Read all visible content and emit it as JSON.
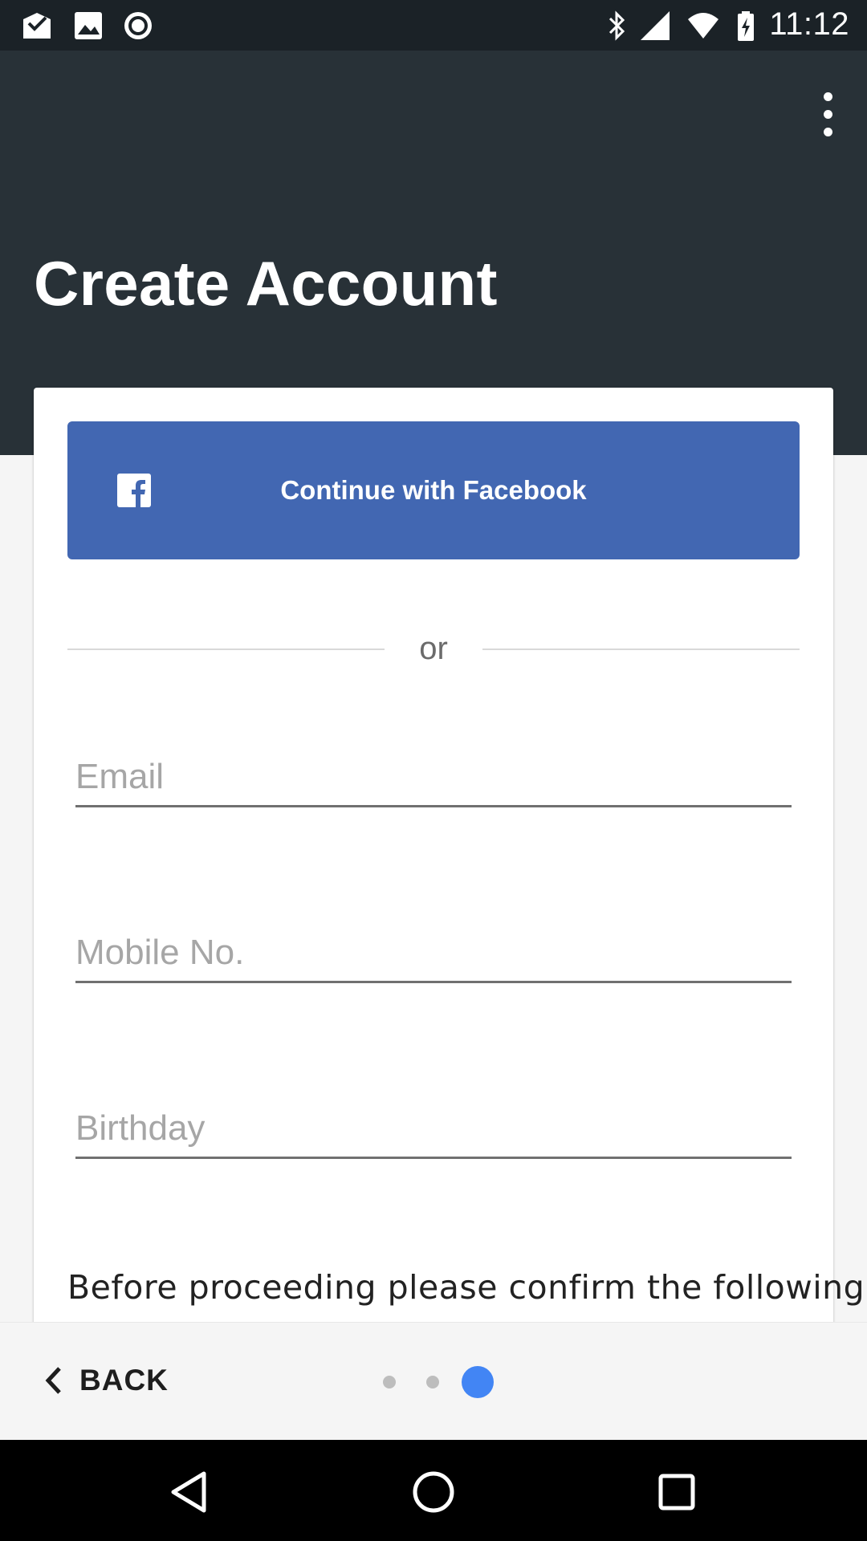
{
  "status_bar": {
    "time": "11:12",
    "left_icons": [
      "mail-check-icon",
      "image-icon",
      "record-icon"
    ],
    "right_icons": [
      "bluetooth-icon",
      "signal-icon",
      "wifi-icon",
      "battery-charging-icon"
    ]
  },
  "header": {
    "title": "Create Account",
    "menu_icon": "more-vert-icon"
  },
  "facebook_button": {
    "label": "Continue with Facebook",
    "icon": "facebook-icon",
    "color": "#4267b2"
  },
  "divider": {
    "label": "or"
  },
  "form": {
    "email": {
      "placeholder": "Email",
      "value": ""
    },
    "mobile": {
      "placeholder": "Mobile No.",
      "value": ""
    },
    "birthday": {
      "placeholder": "Birthday",
      "value": ""
    }
  },
  "confirm_text": "Before proceeding please confirm the following:",
  "bottom_bar": {
    "back_label": "BACK",
    "page_indicator": {
      "total": 3,
      "current": 3
    },
    "active_dot_color": "#4285f4"
  },
  "nav_bar": {
    "buttons": [
      "back-triangle-icon",
      "home-circle-icon",
      "recents-square-icon"
    ]
  },
  "colors": {
    "header": "#283137",
    "status_bar": "#1b2227"
  }
}
